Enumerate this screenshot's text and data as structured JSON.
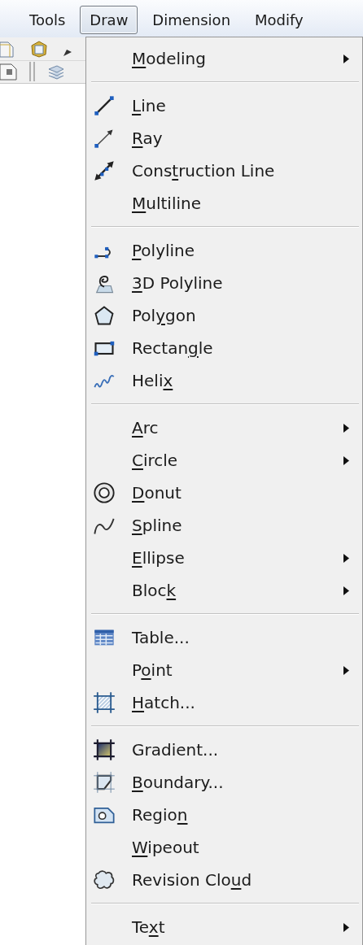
{
  "menubar": [
    {
      "label": "Tools",
      "selected": false
    },
    {
      "label": "Draw",
      "selected": true
    },
    {
      "label": "Dimension",
      "selected": false
    },
    {
      "label": "Modify",
      "selected": false
    }
  ],
  "menu": {
    "groups": [
      [
        {
          "key": "M",
          "after": "odeling",
          "submenu": true
        }
      ],
      [
        {
          "key": "L",
          "after": "ine",
          "submenu": false
        },
        {
          "key": "R",
          "after": "ay",
          "submenu": false
        },
        {
          "before": "Cons",
          "key": "t",
          "after": "ruction Line",
          "submenu": false
        },
        {
          "key": "M",
          "after": "ultiline",
          "submenu": false
        }
      ],
      [
        {
          "key": "P",
          "after": "olyline",
          "submenu": false
        },
        {
          "key": "3",
          "after": "D Polyline",
          "submenu": false
        },
        {
          "before": "Pol",
          "key": "y",
          "after": "gon",
          "submenu": false
        },
        {
          "before": "Rectan",
          "key": "g",
          "after": "le",
          "submenu": false
        },
        {
          "before": "Heli",
          "key": "x",
          "submenu": false
        }
      ],
      [
        {
          "key": "A",
          "after": "rc",
          "submenu": true
        },
        {
          "key": "C",
          "after": "ircle",
          "submenu": true
        },
        {
          "key": "D",
          "after": "onut",
          "submenu": false
        },
        {
          "key": "S",
          "after": "pline",
          "submenu": false
        },
        {
          "key": "E",
          "after": "llipse",
          "submenu": true
        },
        {
          "before": "Bloc",
          "key": "k",
          "submenu": true
        }
      ],
      [
        {
          "before": "Table...",
          "submenu": false
        },
        {
          "before": "P",
          "key": "o",
          "after": "int",
          "submenu": true
        },
        {
          "key": "H",
          "after": "atch...",
          "submenu": false
        }
      ],
      [
        {
          "before": "Gradient...",
          "submenu": false
        },
        {
          "key": "B",
          "after": "oundary...",
          "submenu": false
        },
        {
          "before": "Regio",
          "key": "n",
          "submenu": false
        },
        {
          "key": "W",
          "after": "ipeout",
          "submenu": false
        },
        {
          "before": "Revision Clo",
          "key": "u",
          "after": "d",
          "submenu": false
        }
      ],
      [
        {
          "before": "Te",
          "key": "x",
          "after": "t",
          "submenu": true
        }
      ]
    ]
  }
}
